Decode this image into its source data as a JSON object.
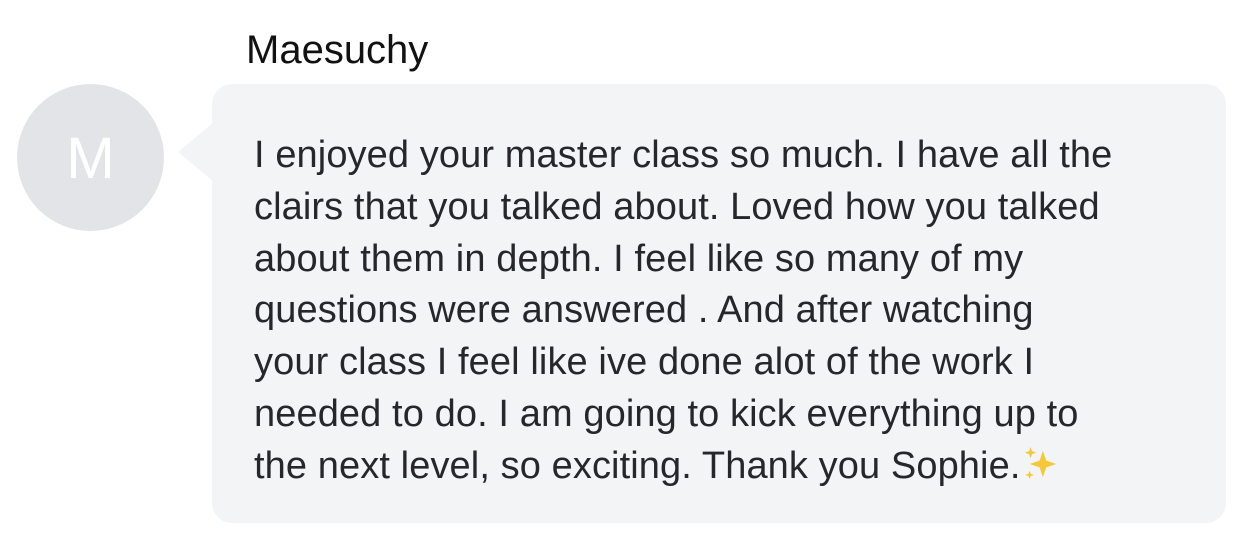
{
  "message": {
    "sender_name": "Maesuchy",
    "avatar_initial": "M",
    "lines": [
      "I enjoyed your master class so much. I have all the",
      "clairs that you talked about. Loved how you talked",
      "about them in depth. I feel like so many of my",
      "questions were answered . And after watching",
      "your class I feel like ive done alot of the work I",
      "needed to do. I am going to kick everything up to",
      "the next level, so exciting. Thank you Sophie."
    ],
    "trailing_emoji": "sparkles-icon"
  },
  "colors": {
    "bubble_background": "#f3f4f6",
    "avatar_background": "#e3e4e8",
    "text": "#26262b",
    "sparkle": "#f5c83a"
  }
}
